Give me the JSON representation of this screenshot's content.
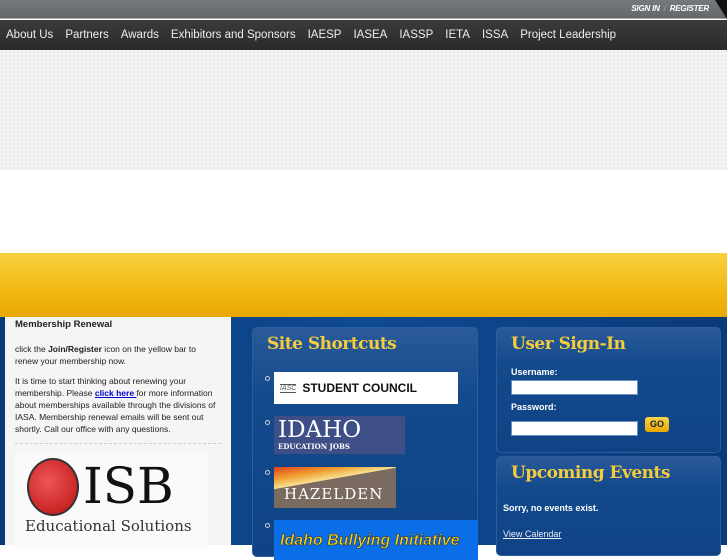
{
  "topbar": {
    "sign_in": "SIGN IN",
    "separator": "/",
    "register": "REGISTER"
  },
  "nav": [
    "About Us",
    "Partners",
    "Awards",
    "Exhibitors and Sponsors",
    "IAESP",
    "IASEA",
    "IASSP",
    "IETA",
    "ISSA",
    "Project Leadership"
  ],
  "membership": {
    "title": "Membership Renewal",
    "p1_pre": "click the ",
    "p1_bold": "Join/Register",
    "p1_post": " icon on the yellow bar to renew your membership now.",
    "p2_pre": "It is time to start thinking about renewing your membership. Please ",
    "p2_link": "click here ",
    "p2_post": "for more information about memberships available through the divisions of IASA. Membership renewal emails will be sent out shortly. Call our office with any questions."
  },
  "isb": {
    "name": "ISB",
    "tagline": "Educational Solutions"
  },
  "shortcuts": {
    "title": "Site Shortcuts",
    "items": [
      {
        "text": "STUDENT COUNCIL",
        "logo": "IASC"
      },
      {
        "text": "IDAHO",
        "sub": "EDUCATION JOBS"
      },
      {
        "text": "HAZELDEN"
      },
      {
        "text": "Idaho Bullying Initiative"
      }
    ]
  },
  "signin": {
    "title": "User Sign-In",
    "username_label": "Username:",
    "password_label": "Password:",
    "username": "",
    "password": "",
    "go": "GO"
  },
  "events": {
    "title": "Upcoming Events",
    "empty": "Sorry, no events exist.",
    "calendar_link": "View Calendar"
  }
}
